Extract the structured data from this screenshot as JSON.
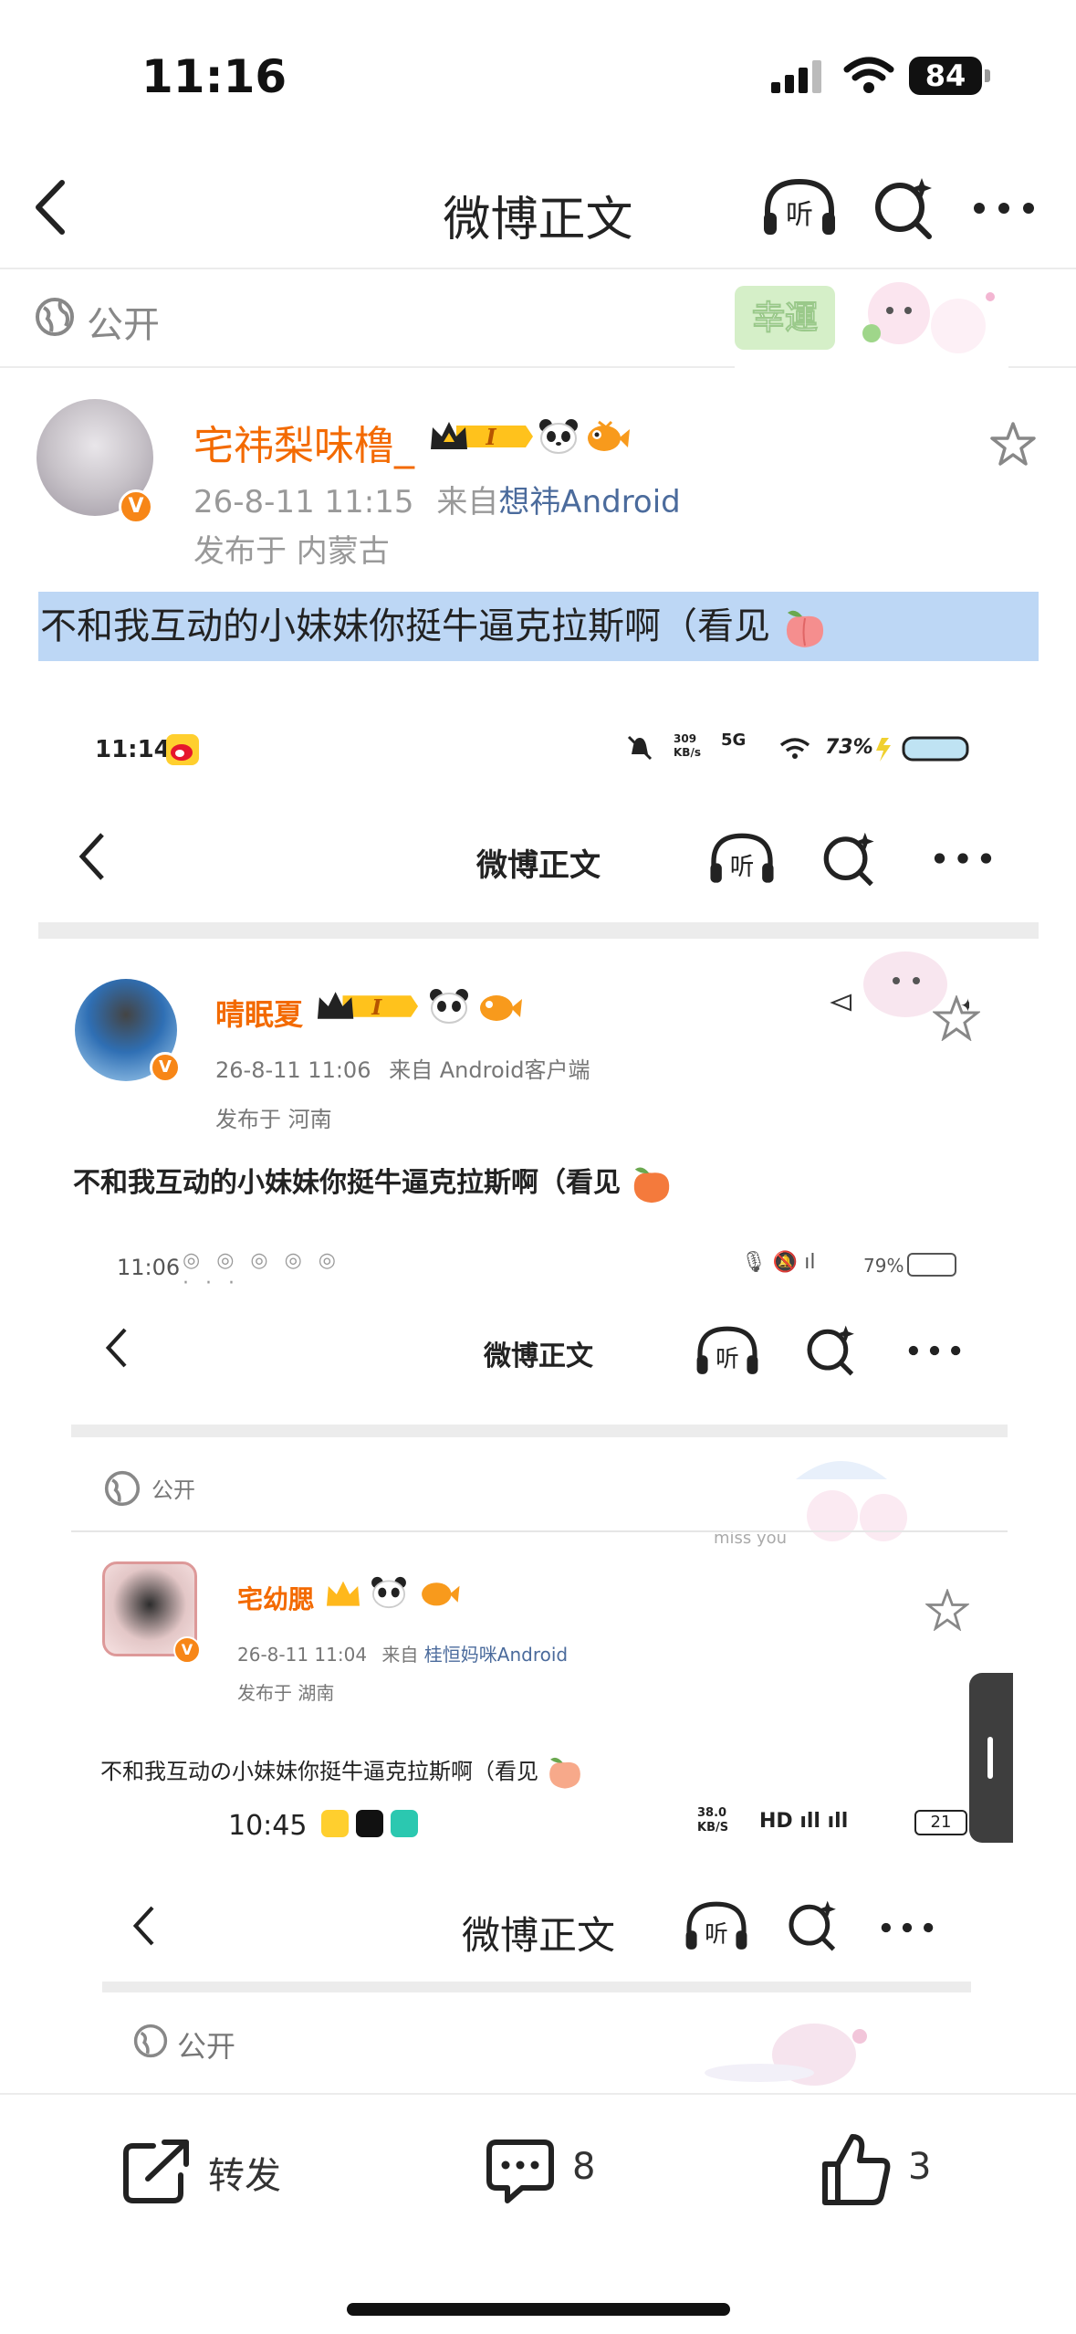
{
  "status_bar": {
    "time": "11:16",
    "battery": "84"
  },
  "nav": {
    "title": "微博正文"
  },
  "visibility": {
    "label": "公开"
  },
  "post": {
    "username": "宅祎梨味橹_",
    "date": "26-8-11 11:15",
    "from_prefix": "来自",
    "device": "想祎Android",
    "location": "发布于 内蒙古",
    "text": "不和我互动的小妹妹你挺牛逼克拉斯啊（看见"
  },
  "embedded_1": {
    "status_time": "11:14",
    "net_speed": "309 KB/s",
    "net_type": "5G",
    "battery": "73%",
    "nav_title": "微博正文",
    "username": "晴眠夏",
    "date": "26-8-11 11:06",
    "from_prefix": "来自",
    "device": "Android客户端",
    "location": "发布于 河南",
    "text": "不和我互动的小妹妹你挺牛逼克拉斯啊（看见"
  },
  "embedded_2": {
    "status_time": "11:06",
    "battery": "79%",
    "nav_title": "微博正文",
    "visibility": "公开",
    "username": "宅幼腮",
    "date": "26-8-11 11:04",
    "from_prefix": "来自",
    "device": "桂恒妈咪Android",
    "location": "发布于 湖南",
    "text": "不和我互动の小妹妹你挺牛逼克拉斯啊（看见"
  },
  "embedded_3": {
    "status_time": "10:45",
    "net_speed": "38.0 KB/S",
    "battery": "21",
    "nav_title": "微博正文",
    "visibility": "公开"
  },
  "bottom_bar": {
    "repost_label": "转发",
    "comment_count": "8",
    "like_count": "3"
  },
  "colors": {
    "username_orange": "#f36a00",
    "highlight_blue": "#bdd7f5",
    "link_blue": "#4b6b9c"
  }
}
